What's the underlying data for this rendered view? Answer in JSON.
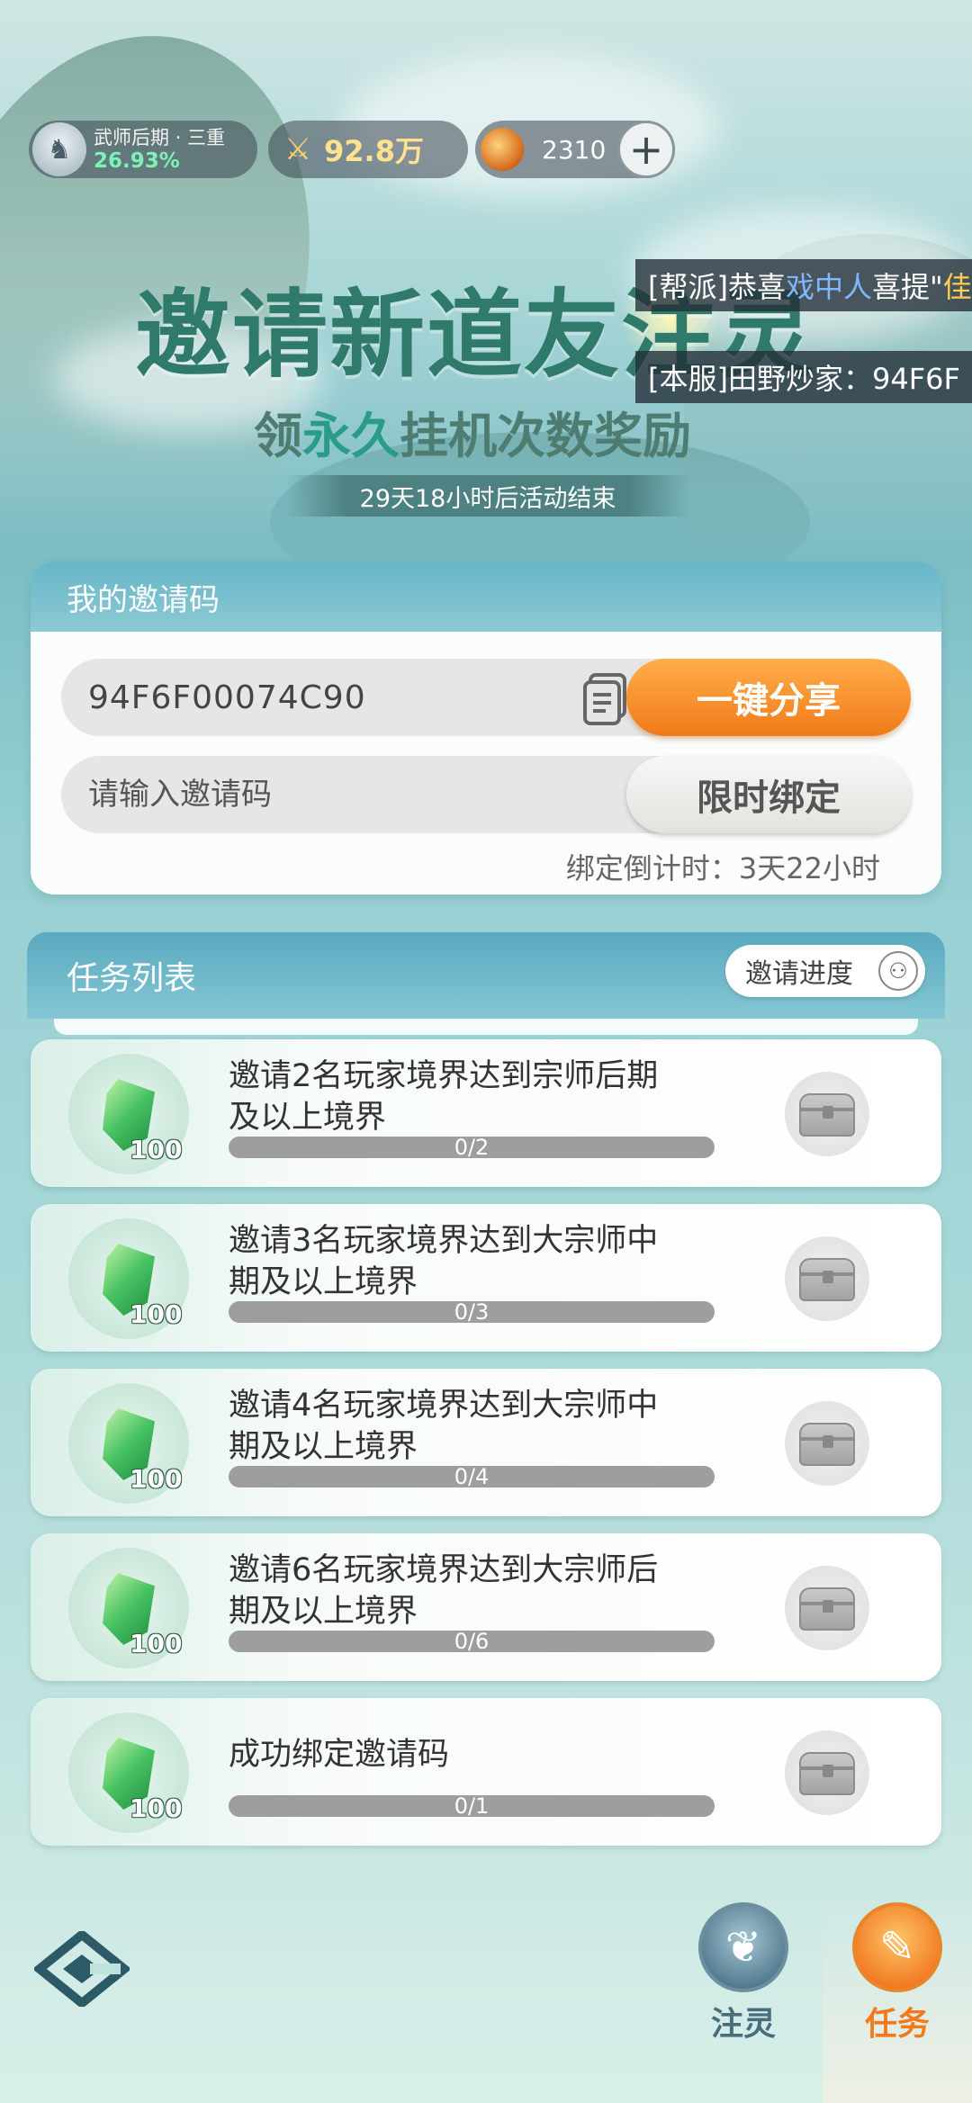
{
  "status_bar": {
    "realm_name": "武师后期 · 三重",
    "realm_progress": "26.93%",
    "power_value": "92.8万",
    "currency_value": "2310",
    "plus_label": "+"
  },
  "event": {
    "title": "邀请新道友注灵",
    "subtitle_pre": "领",
    "subtitle_emph": "永久",
    "subtitle_post": "挂机次数奖励",
    "countdown": "29天18小时后活动结束"
  },
  "chat": {
    "line1_prefix": "[帮派]恭喜",
    "line1_name": "戏中人",
    "line1_suffix": "喜提\"",
    "line1_tail": "佳",
    "line2": "[本服]田野炒家：94F6F"
  },
  "invite_card": {
    "header": "我的邀请码",
    "code": "94F6F00074C90",
    "share_label": "一键分享",
    "input_placeholder": "请输入邀请码",
    "bind_label": "限时绑定",
    "bind_timer": "绑定倒计时：3天22小时"
  },
  "task_list": {
    "header": "任务列表",
    "progress_button": "邀请进度",
    "items": [
      {
        "title_line1": "邀请2名玩家境界达到宗师后期",
        "title_line2": "及以上境界",
        "reward_qty": "100",
        "progress_text": "0/2",
        "progress": 0
      },
      {
        "title_line1": "邀请3名玩家境界达到大宗师中",
        "title_line2": "期及以上境界",
        "reward_qty": "100",
        "progress_text": "0/3",
        "progress": 0
      },
      {
        "title_line1": "邀请4名玩家境界达到大宗师中",
        "title_line2": "期及以上境界",
        "reward_qty": "100",
        "progress_text": "0/4",
        "progress": 0
      },
      {
        "title_line1": "邀请6名玩家境界达到大宗师后",
        "title_line2": "期及以上境界",
        "reward_qty": "100",
        "progress_text": "0/6",
        "progress": 0
      },
      {
        "title_line1": "成功绑定邀请码",
        "title_line2": "",
        "reward_qty": "100",
        "progress_text": "0/1",
        "progress": 0
      }
    ]
  },
  "bottom_nav": {
    "lingzhu_label": "注灵",
    "task_label": "任务"
  },
  "icons": {
    "realm_avatar": "character-avatar-icon",
    "power": "crossed-swords-icon",
    "currency": "spirit-coin-icon",
    "copy": "copy-icon",
    "progress_person": "person-add-icon",
    "reward": "green-jade-icon",
    "chest": "treasure-chest-icon",
    "logo": "game-logo-icon",
    "nav_lingzhu": "leaf-spirit-icon",
    "nav_task": "scroll-task-icon"
  },
  "colors": {
    "accent_orange": "#f07a18",
    "card_header": "#66b5c8",
    "progress_track": "#9e9e9e",
    "realm_percent": "#7cf2b7"
  }
}
